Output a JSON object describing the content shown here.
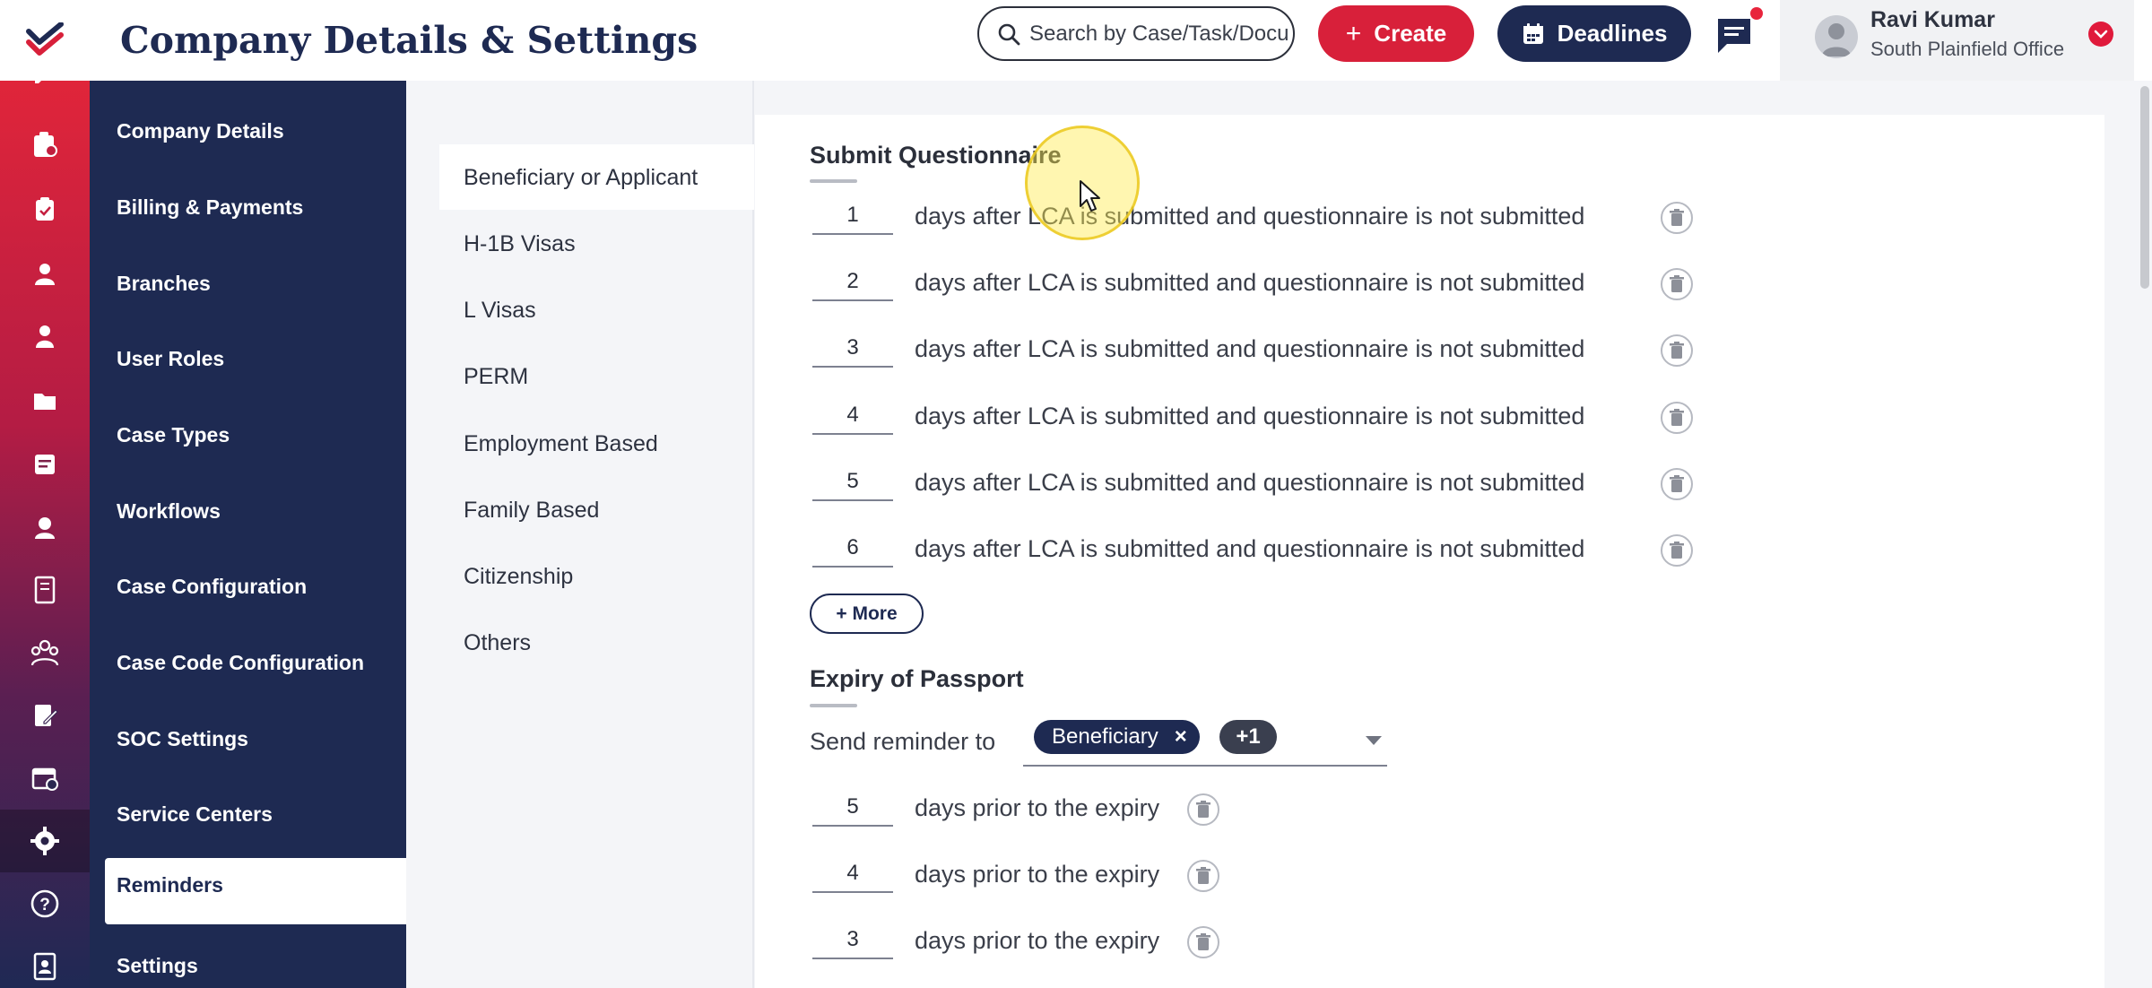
{
  "header": {
    "title": "Company Details & Settings",
    "search_placeholder": "Search by Case/Task/Docu",
    "create_label": "Create",
    "deadlines_label": "Deadlines",
    "user": {
      "name": "Ravi Kumar",
      "office": "South Plainfield Office"
    }
  },
  "rail_icons": [
    "edit-icon",
    "case-icon",
    "clipboard-icon",
    "person-icon",
    "user-icon",
    "folder-icon",
    "notes-icon",
    "support-agent-icon",
    "ledger-icon",
    "team-icon",
    "form-icon",
    "calendar-icon",
    "settings-gear-icon",
    "help-icon",
    "address-book-icon"
  ],
  "settings_nav": {
    "items": [
      "Company Details",
      "Billing & Payments",
      "Branches",
      "User Roles",
      "Case Types",
      "Workflows",
      "Case Configuration",
      "Case Code Configuration",
      "SOC Settings",
      "Service Centers",
      "Reminders",
      "Settings"
    ],
    "active": "Reminders"
  },
  "sub_nav": {
    "items": [
      "Beneficiary or Applicant",
      "H-1B Visas",
      "L Visas",
      "PERM",
      "Employment Based",
      "Family Based",
      "Citizenship",
      "Others"
    ],
    "active": "Beneficiary or Applicant"
  },
  "submit_questionnaire": {
    "title": "Submit Questionnaire",
    "rows": [
      {
        "value": "1",
        "text": "days after LCA is submitted and questionnaire is not submitted"
      },
      {
        "value": "2",
        "text": "days after LCA is submitted and questionnaire is not submitted"
      },
      {
        "value": "3",
        "text": "days after LCA is submitted and questionnaire is not submitted"
      },
      {
        "value": "4",
        "text": "days after LCA is submitted and questionnaire is not submitted"
      },
      {
        "value": "5",
        "text": "days after LCA is submitted and questionnaire is not submitted"
      },
      {
        "value": "6",
        "text": "days after LCA is submitted and questionnaire is not submitted"
      }
    ],
    "more_label": "+ More"
  },
  "expiry_of_passport": {
    "title": "Expiry of Passport",
    "send_label": "Send reminder to",
    "chip_label": "Beneficiary",
    "chip_remove": "×",
    "extra_count": "+1",
    "rows": [
      {
        "value": "5",
        "text": "days prior to the expiry"
      },
      {
        "value": "4",
        "text": "days prior to the expiry"
      },
      {
        "value": "3",
        "text": "days prior to the expiry"
      }
    ]
  },
  "colors": {
    "navy": "#1e2a52",
    "brand_red": "#d8203a",
    "rail_gradient_top": "#e0253a",
    "rail_gradient_bottom": "#1f2954"
  }
}
